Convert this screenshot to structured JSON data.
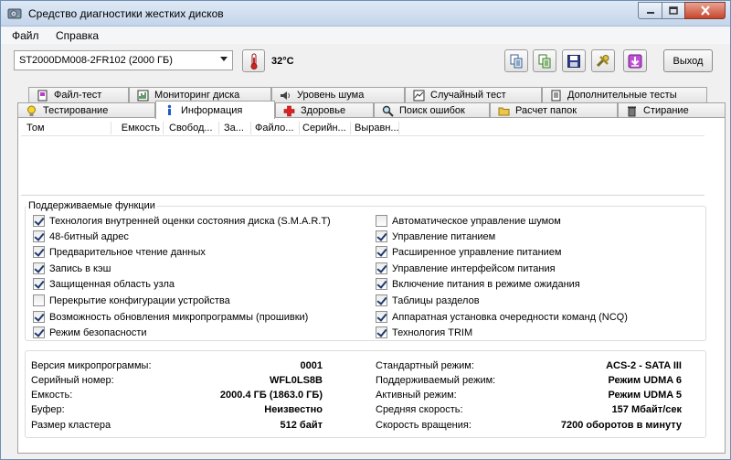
{
  "window": {
    "title": "Средство диагностики жестких дисков"
  },
  "menu": {
    "file": "Файл",
    "help": "Справка"
  },
  "toolbar": {
    "drive": "ST2000DM008-2FR102 (2000 ГБ)",
    "temperature": "32°C",
    "exit": "Выход",
    "icons": [
      "copy-icon",
      "copy-green-icon",
      "save-icon",
      "tools-icon",
      "download-icon"
    ]
  },
  "tabs_top": [
    {
      "label": "Файл-тест",
      "icon": "file-icon"
    },
    {
      "label": "Мониторинг диска",
      "icon": "monitor-icon"
    },
    {
      "label": "Уровень шума",
      "icon": "speaker-icon"
    },
    {
      "label": "Случайный тест",
      "icon": "chart-icon"
    },
    {
      "label": "Дополнительные тесты",
      "icon": "document-icon"
    }
  ],
  "tabs_bottom": [
    {
      "label": "Тестирование",
      "icon": "bulb-icon"
    },
    {
      "label": "Информация",
      "icon": "info-icon",
      "active": true
    },
    {
      "label": "Здоровье",
      "icon": "health-cross-icon"
    },
    {
      "label": "Поиск ошибок",
      "icon": "magnifier-icon"
    },
    {
      "label": "Расчет папок",
      "icon": "folder-icon"
    },
    {
      "label": "Стирание",
      "icon": "trash-icon"
    }
  ],
  "volumes_table": {
    "columns": [
      "Том",
      "Емкость",
      "Свобод...",
      "За...",
      "Файло...",
      "Серийн...",
      "Выравн..."
    ]
  },
  "features": {
    "title": "Поддерживаемые функции",
    "left": [
      {
        "label": "Технология внутренней оценки состояния диска (S.M.A.R.T)",
        "checked": true
      },
      {
        "label": "48-битный адрес",
        "checked": true
      },
      {
        "label": "Предварительное чтение данных",
        "checked": true
      },
      {
        "label": "Запись в кэш",
        "checked": true
      },
      {
        "label": "Защищенная область узла",
        "checked": true
      },
      {
        "label": "Перекрытие конфигурации устройства",
        "checked": false
      },
      {
        "label": "Возможность обновления микропрограммы (прошивки)",
        "checked": true
      },
      {
        "label": "Режим безопасности",
        "checked": true
      }
    ],
    "right": [
      {
        "label": "Автоматическое управление шумом",
        "checked": false
      },
      {
        "label": "Управление питанием",
        "checked": true
      },
      {
        "label": "Расширенное управление питанием",
        "checked": true
      },
      {
        "label": "Управление интерфейсом питания",
        "checked": true
      },
      {
        "label": "Включение питания в режиме ожидания",
        "checked": true
      },
      {
        "label": "Таблицы разделов",
        "checked": true
      },
      {
        "label": "Аппаратная установка очередности команд (NCQ)",
        "checked": true
      },
      {
        "label": "Технология TRIM",
        "checked": true
      }
    ]
  },
  "info": {
    "left": [
      {
        "label": "Версия микропрограммы:",
        "value": "0001"
      },
      {
        "label": "Серийный номер:",
        "value": "WFL0LS8B"
      },
      {
        "label": "Емкость:",
        "value": "2000.4 ГБ (1863.0 ГБ)"
      },
      {
        "label": "Буфер:",
        "value": "Неизвестно"
      },
      {
        "label": "Размер кластера",
        "value": "512 байт"
      }
    ],
    "right": [
      {
        "label": "Стандартный режим:",
        "value": "ACS-2 - SATA III"
      },
      {
        "label": "Поддерживаемый режим:",
        "value": "Режим UDMA 6"
      },
      {
        "label": "Активный режим:",
        "value": "Режим UDMA 5"
      },
      {
        "label": "Средняя скорость:",
        "value": "157 Мбайт/сек"
      },
      {
        "label": "Скорость вращения:",
        "value": "7200 оборотов в минуту"
      }
    ]
  }
}
